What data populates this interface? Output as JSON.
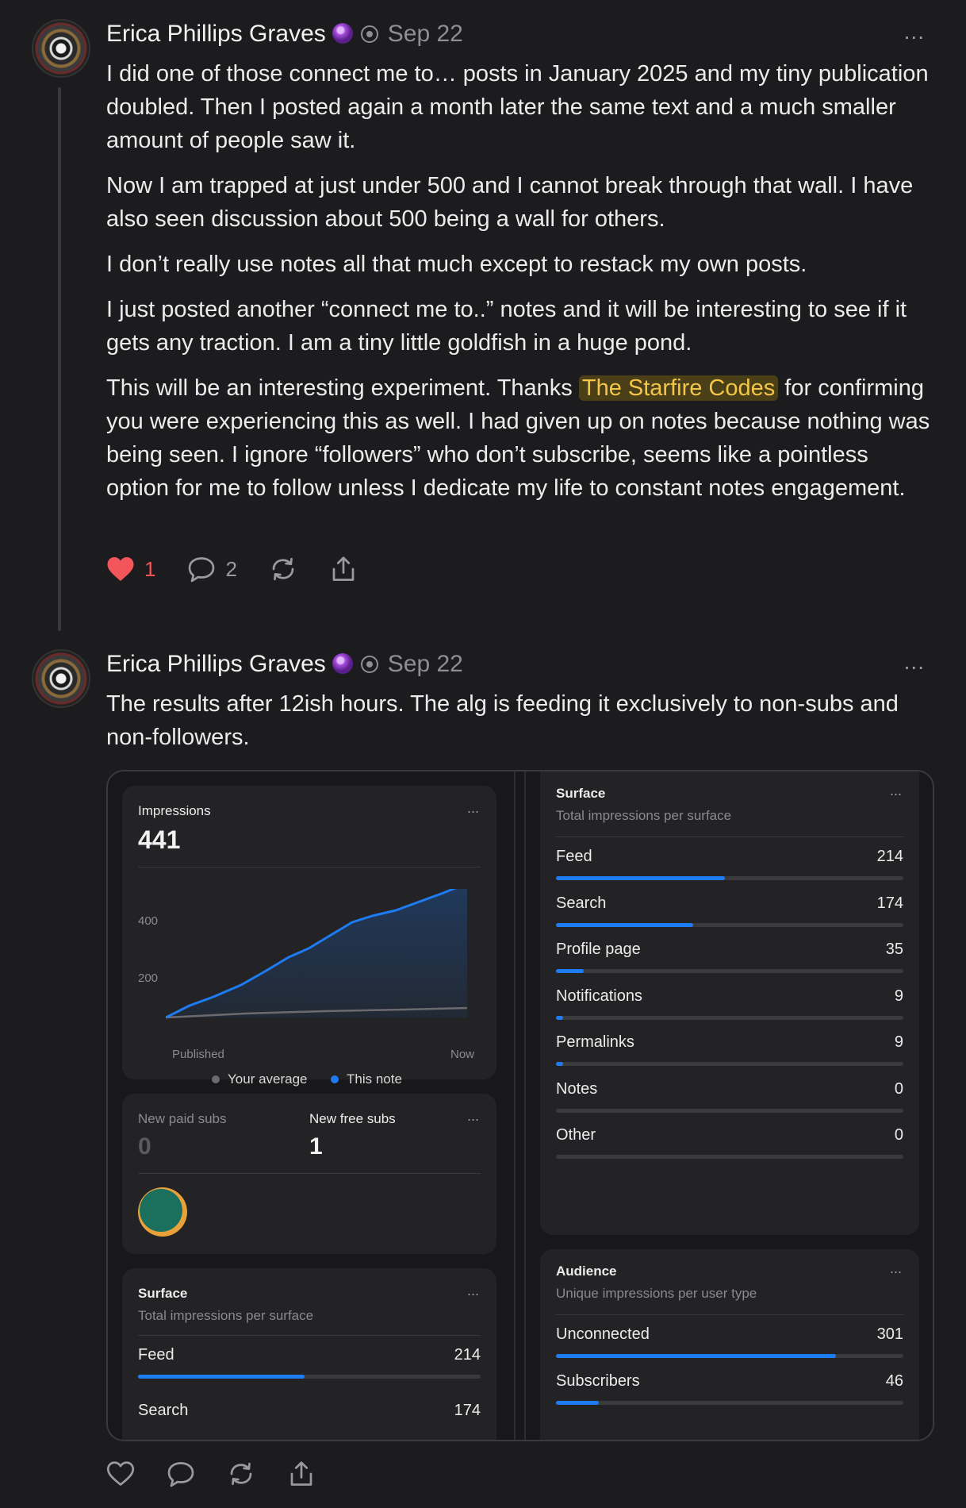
{
  "notes": [
    {
      "author": "Erica Phillips Graves",
      "date": "Sep 22",
      "more": "...",
      "paragraphs": [
        "I did one of those connect me to… posts in January 2025 and my tiny publication doubled. Then I posted again a month later the same text and a much smaller amount of people saw it.",
        "Now I am trapped at just under 500 and I cannot break through that wall. I have also seen discussion about 500 being a wall for others.",
        "I don’t really use notes all that much except to restack my own posts.",
        "I just posted another “connect me to..” notes and it will be interesting to see if it gets any traction. I am a tiny little goldfish in a huge pond."
      ],
      "last_paragraph": {
        "before": "This will be an interesting experiment. Thanks ",
        "mention": "The Starfire Codes",
        "after": " for confirming you were experiencing this as well. I had given up on notes because nothing was being seen. I ignore “followers” who don’t subscribe, seems like a pointless option for me to follow unless I dedicate my life to constant notes engagement."
      },
      "likes": "1",
      "comments": "2"
    },
    {
      "author": "Erica Phillips Graves",
      "date": "Sep 22",
      "more": "...",
      "text": "The results after 12ish hours. The alg is feeding it exclusively to non-subs and non-followers."
    }
  ],
  "stats": {
    "impressions": {
      "title": "Impressions",
      "value": "441",
      "more": "...",
      "y_ticks": [
        "400",
        "200"
      ],
      "x_start": "Published",
      "x_end": "Now",
      "legend_avg": "Your average",
      "legend_note": "This note",
      "colors": {
        "this_note": "#1e7cf2",
        "average": "#6b6b6f"
      }
    },
    "subs": {
      "paid_label": "New paid subs",
      "paid_value": "0",
      "free_label": "New free subs",
      "free_value": "1",
      "more": "..."
    },
    "surface": {
      "title": "Surface",
      "subtitle": "Total impressions per surface",
      "more": "...",
      "rows": [
        {
          "label": "Feed",
          "value": "214",
          "share": 0.486
        },
        {
          "label": "Search",
          "value": "174",
          "share": 0.395
        },
        {
          "label": "Profile page",
          "value": "35",
          "share": 0.079
        },
        {
          "label": "Notifications",
          "value": "9",
          "share": 0.02
        },
        {
          "label": "Permalinks",
          "value": "9",
          "share": 0.02
        },
        {
          "label": "Notes",
          "value": "0",
          "share": 0
        },
        {
          "label": "Other",
          "value": "0",
          "share": 0
        }
      ]
    },
    "audience": {
      "title": "Audience",
      "subtitle": "Unique impressions per user type",
      "more": "...",
      "rows": [
        {
          "label": "Unconnected",
          "value": "301",
          "share": 0.805
        },
        {
          "label": "Subscribers",
          "value": "46",
          "share": 0.123
        }
      ]
    }
  }
}
